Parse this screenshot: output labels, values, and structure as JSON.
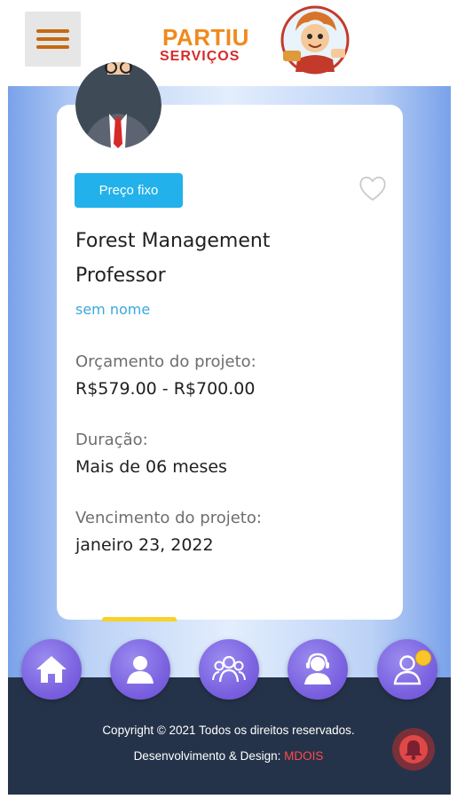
{
  "header": {
    "logo_line1": "PARTIU",
    "logo_line2": "SERVIÇOS"
  },
  "job": {
    "badge": "Preço fixo",
    "title": "Forest Management Professor",
    "client": "sem nome",
    "budget_label": "Orçamento do projeto:",
    "budget_value": "R$579.00 - R$700.00",
    "duration_label": "Duração:",
    "duration_value": "Mais de 06 meses",
    "deadline_label": "Vencimento do projeto:",
    "deadline_value": "janeiro 23, 2022"
  },
  "bottom_nav": {
    "items": [
      {
        "icon": "home-icon"
      },
      {
        "icon": "user-icon"
      },
      {
        "icon": "users-group-icon"
      },
      {
        "icon": "support-agent-icon"
      },
      {
        "icon": "profile-notification-icon"
      }
    ]
  },
  "footer": {
    "copyright": "Copyright © 2021 Todos os direitos reservados.",
    "credit_prefix": "Desenvolvimento & Design: ",
    "credit_brand": "MDOIS"
  },
  "colors": {
    "badge": "#22b1ea",
    "footer_bg": "#25334a",
    "nav_button": "#7b62e0",
    "brand_red": "#ff4a4a",
    "logo_orange": "#f08a1c"
  }
}
